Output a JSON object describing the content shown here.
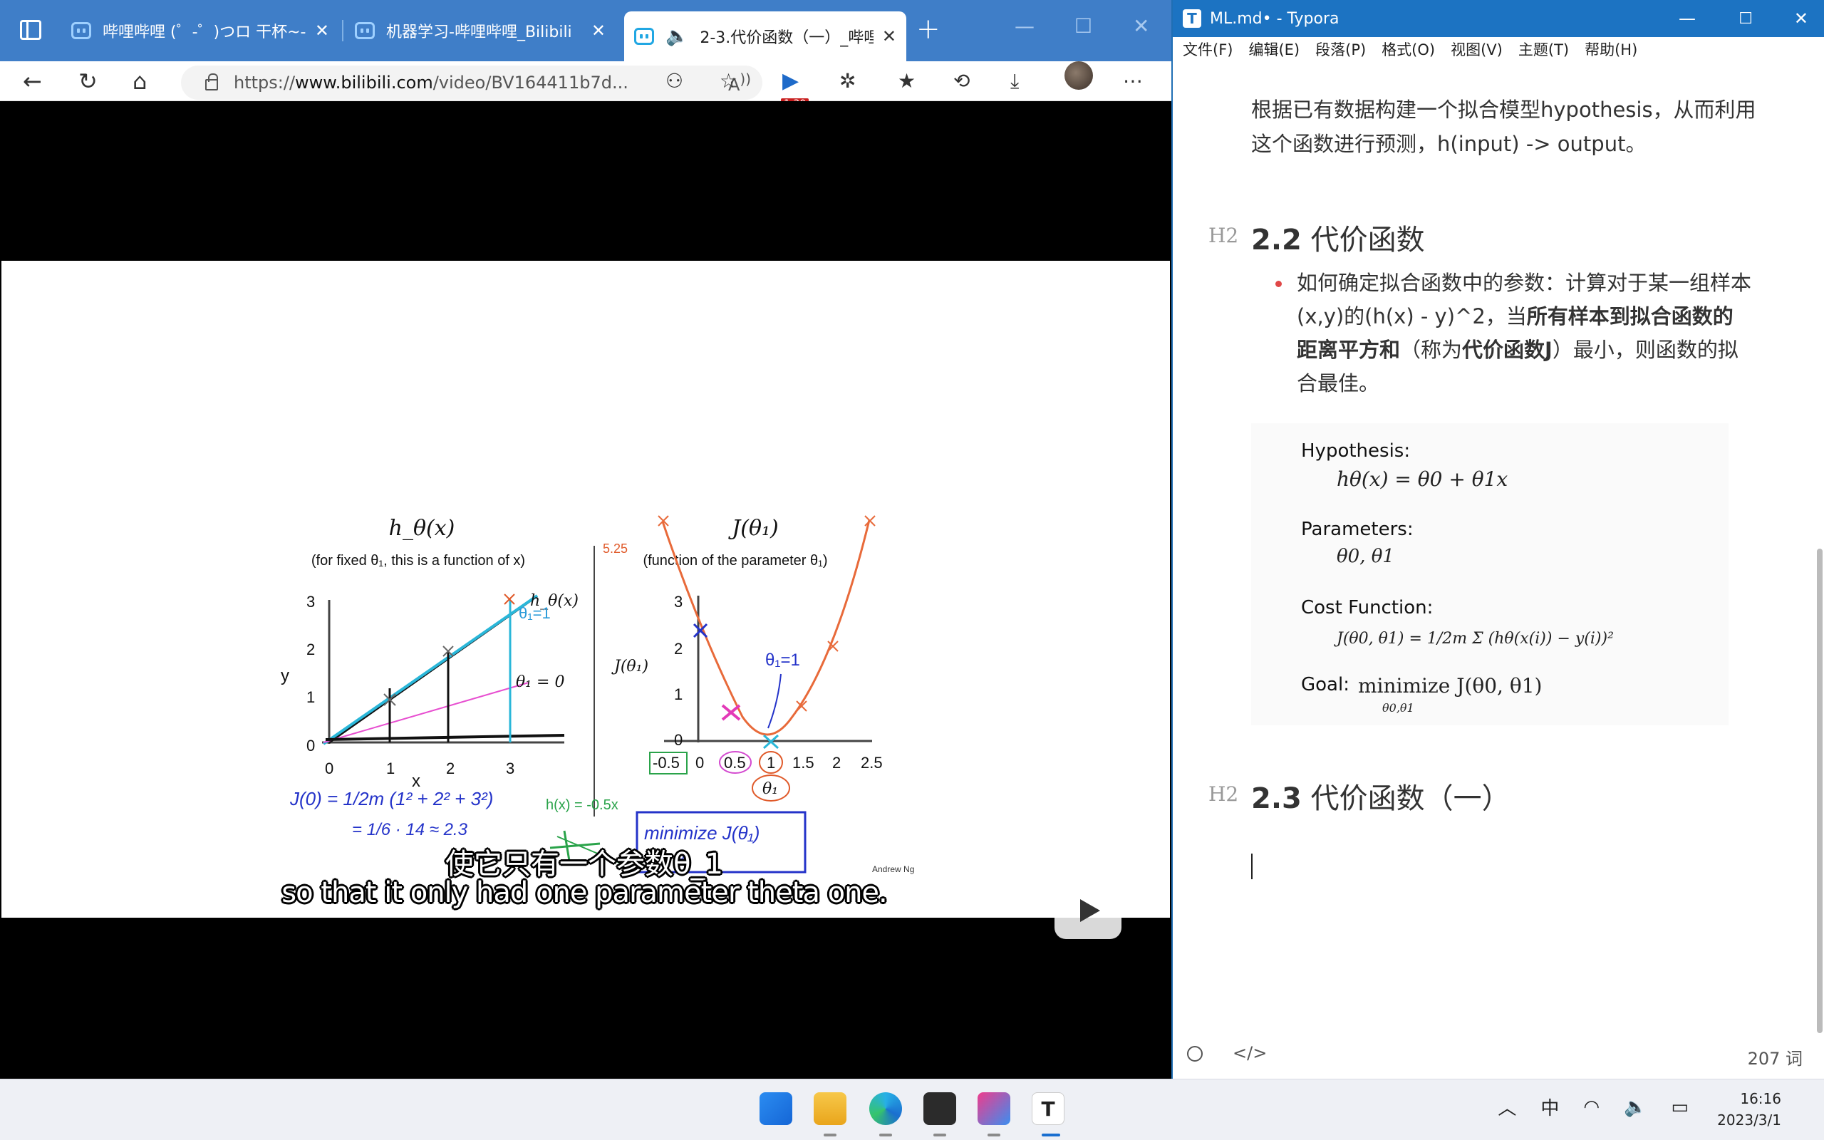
{
  "browser": {
    "tabs": [
      {
        "title": "哔哩哔哩 (゜-゜)つロ 干杯~-bi",
        "active": false
      },
      {
        "title": "机器学习-哔哩哔哩_Bilibili",
        "active": false
      },
      {
        "title": "2-3.代价函数（一）_哔哩",
        "active": true
      }
    ],
    "address": {
      "prefix": "https://",
      "host": "www.bilibili.com",
      "path": "/video/BV164411b7d..."
    },
    "extension_badge": "1.30",
    "slide": {
      "left_title": "h_θ(x)",
      "left_subtitle": "(for fixed θ₁, this is a function of x)",
      "right_title": "J(θ₁)",
      "right_subtitle": "(function of the parameter θ₁)",
      "y_label": "y",
      "x_label": "x",
      "j_label": "J(θ₁)",
      "theta_label": "θ₁",
      "h_label": "h_θ(x)",
      "theta_eq": "θ₁ = 0",
      "credit": "Andrew Ng",
      "left_x_ticks": [
        "0",
        "1",
        "2",
        "3"
      ],
      "left_y_ticks": [
        "0",
        "1",
        "2",
        "3"
      ],
      "right_x_ticks": [
        "-0.5",
        "0",
        "0.5",
        "1",
        "1.5",
        "2",
        "2.5"
      ],
      "right_y_ticks": [
        "0",
        "1",
        "2",
        "3"
      ],
      "hand_notes": {
        "theta_1": "θ₁=1",
        "theta_1_b": "θ₁=1",
        "j_formula": "J(0) = 1/2m (1² + 2² + 3²)",
        "j_value": "= 1/6 · 14 ≈ 2.3",
        "hx_eq": "h(x) = -0.5x",
        "minimize": "minimize J(θ₁)",
        "minimize_sub": "θ₁",
        "five": "5.25",
        "hx_small": "h(x)"
      }
    },
    "subtitle_cn": "使它只有一个参数θ_1",
    "subtitle_en": "so that it only had one parameter theta one."
  },
  "typora": {
    "title": "ML.md• - Typora",
    "menu": [
      "文件(F)",
      "编辑(E)",
      "段落(P)",
      "格式(O)",
      "视图(V)",
      "主题(T)",
      "帮助(H)"
    ],
    "intro_para": "根据已有数据构建一个拟合模型hypothesis，从而利用这个函数进行预测，h(input) -> output。",
    "h2_marker": "H2",
    "h2_a_num": "2.2",
    "h2_a_text": "代价函数",
    "bullet_pre": "如何确定拟合函数中的参数：计算对于某一组样本(x,y)的(h(x) - y)^2，当",
    "bullet_bold1": "所有样本到拟合函数的距离平方和",
    "bullet_mid": "（称为",
    "bullet_bold2": "代价函数J",
    "bullet_post": "）最小，则函数的拟合最佳。",
    "img": {
      "hyp_label": "Hypothesis:",
      "hyp_math": "hθ(x) = θ0 + θ1x",
      "param_label": "Parameters:",
      "param_math": "θ0, θ1",
      "cost_label": "Cost Function:",
      "cost_math": "J(θ0, θ1) = 1/2m Σ (hθ(x(i)) − y(i))²",
      "goal_label": "Goal:",
      "goal_math": "minimize J(θ0, θ1)",
      "goal_sub": "θ0,θ1"
    },
    "h2_b_num": "2.3",
    "h2_b_text": "代价函数（一）",
    "word_count": "207 词"
  },
  "taskbar": {
    "ime": "中",
    "time": "16:16",
    "date": "2023/3/1"
  }
}
